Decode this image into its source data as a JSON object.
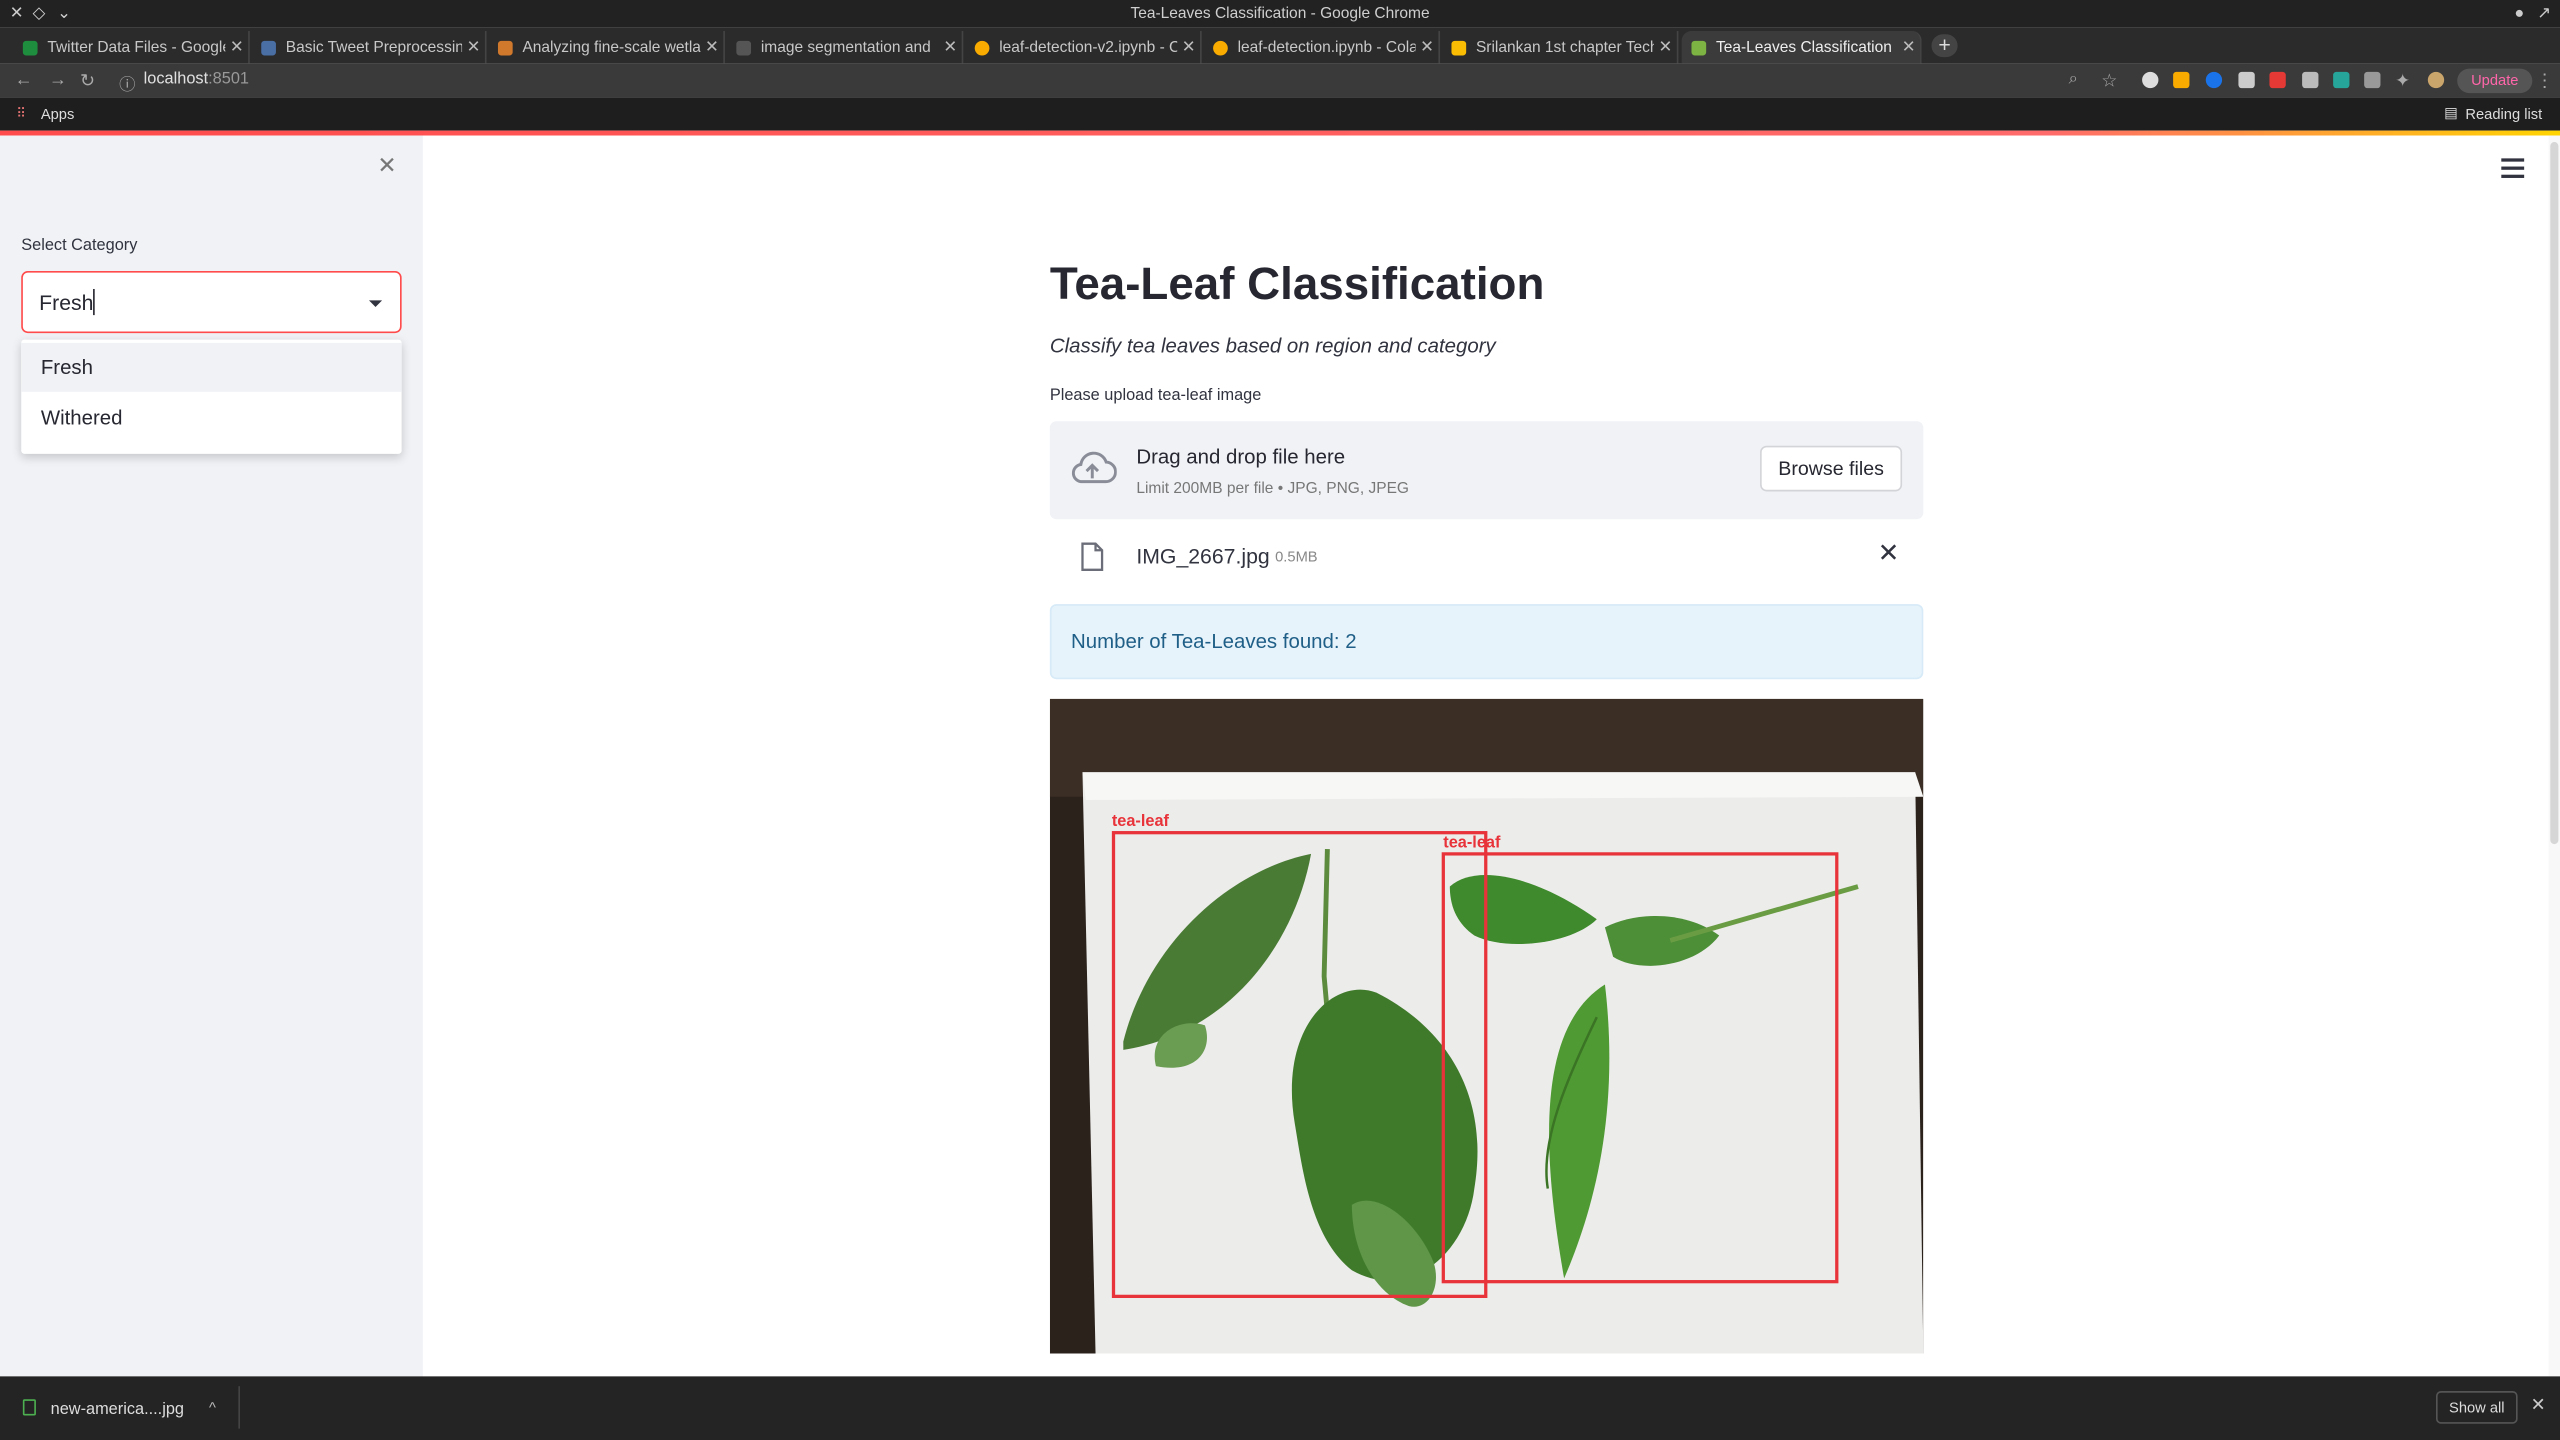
{
  "window": {
    "title": "Tea-Leaves Classification - Google Chrome"
  },
  "tabs": [
    {
      "label": "Twitter Data Files - Google",
      "favicon_color": "#1e8e3e"
    },
    {
      "label": "Basic Tweet Preprocessing",
      "favicon_color": "#4a6fa5"
    },
    {
      "label": "Analyzing fine-scale wetla",
      "favicon_color": "#d0782c"
    },
    {
      "label": "image segmentation and",
      "favicon_color": "#555555"
    },
    {
      "label": "leaf-detection-v2.ipynb - C",
      "favicon_color": "#f9ab00"
    },
    {
      "label": "leaf-detection.ipynb - Cola",
      "favicon_color": "#f9ab00"
    },
    {
      "label": "Srilankan 1st chapter Tech",
      "favicon_color": "#fbbc04"
    },
    {
      "label": "Tea-Leaves Classification",
      "favicon_color": "#7cb342",
      "active": true
    }
  ],
  "address": {
    "host": "localhost",
    "port": ":8501",
    "update_label": "Update"
  },
  "bookmarks": {
    "apps_label": "Apps",
    "reading_list_label": "Reading list"
  },
  "sidebar": {
    "select_label": "Select Category",
    "select_value": "Fresh",
    "options": [
      "Fresh",
      "Withered"
    ]
  },
  "main": {
    "title": "Tea-Leaf Classification",
    "subtitle": "Classify tea leaves based on region and category",
    "upload_label": "Please upload tea-leaf image",
    "dropzone_text": "Drag and drop file here",
    "dropzone_limit": "Limit 200MB per file • JPG, PNG, JPEG",
    "browse_label": "Browse files",
    "file_name": "IMG_2667.jpg",
    "file_size": "0.5MB",
    "info_text": "Number of Tea-Leaves found: 2",
    "detections": [
      {
        "label": "tea-leaf"
      },
      {
        "label": "tea-leaf"
      }
    ]
  },
  "downloads": {
    "file_name": "new-america....jpg",
    "show_all_label": "Show all"
  },
  "colors": {
    "accent": "#ff4b4b",
    "info_bg": "#e6f3fb",
    "info_text": "#1f5f87",
    "sidebar_bg": "#f0f2f6",
    "bbox": "#e8333a"
  }
}
